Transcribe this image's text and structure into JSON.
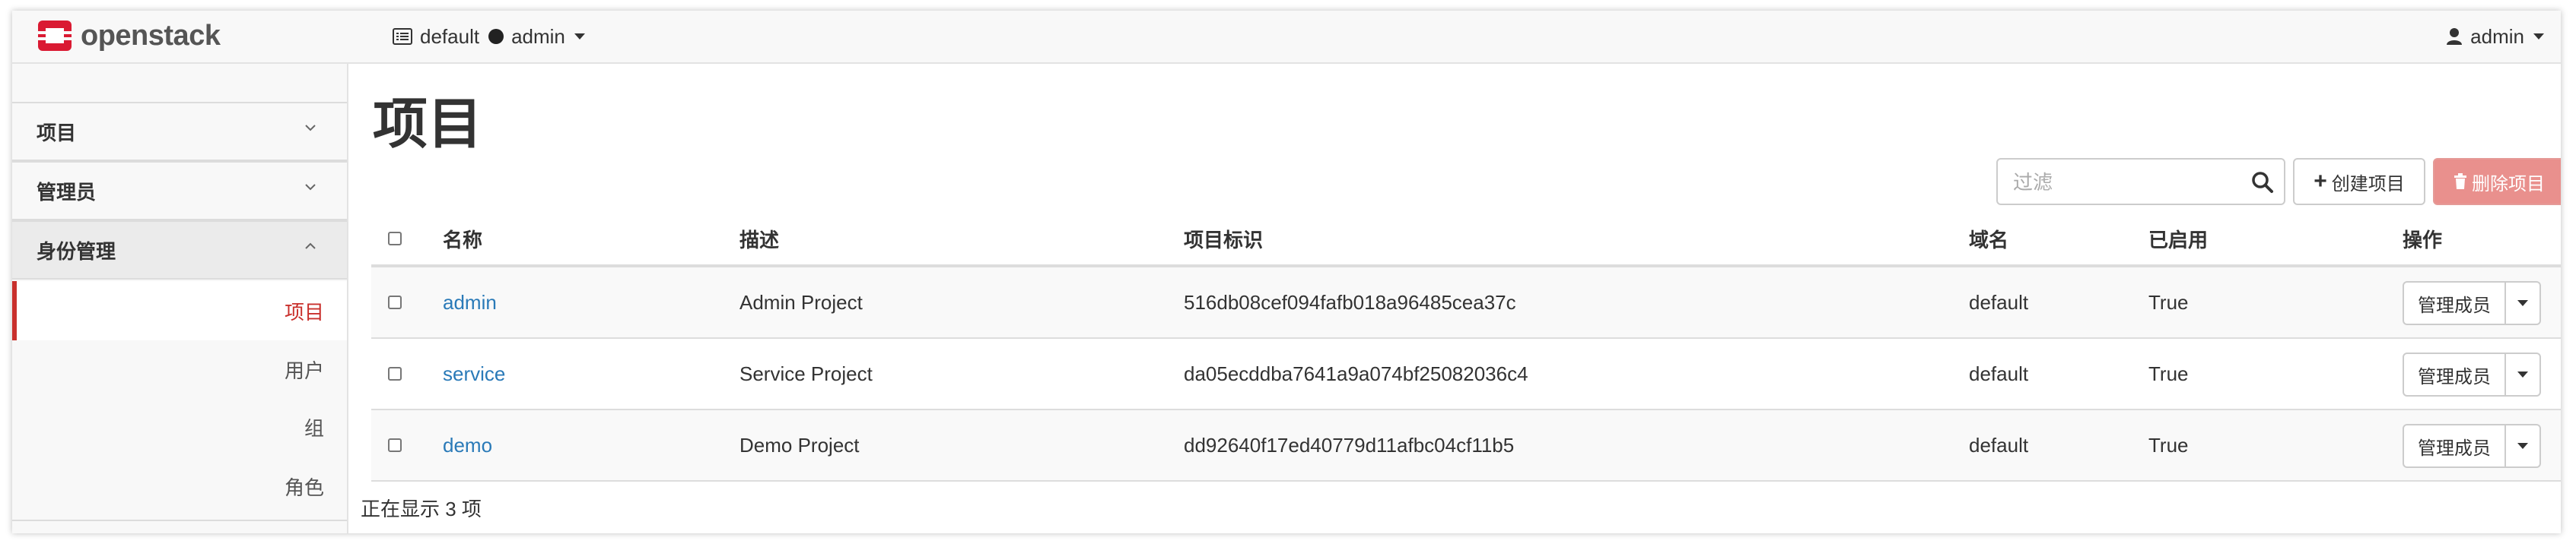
{
  "colors": {
    "accent_red": "#c9302c",
    "link_blue": "#2a7ab8",
    "logo_red": "#da1a32"
  },
  "navbar": {
    "brand": "openstack",
    "domain": "default",
    "project": "admin",
    "user": "admin"
  },
  "sidebar": {
    "sections": [
      {
        "label": "项目",
        "icon": "chevron-down-icon"
      },
      {
        "label": "管理员",
        "icon": "chevron-down-icon"
      },
      {
        "label": "身份管理",
        "icon": "chevron-up-icon"
      }
    ],
    "items": [
      {
        "label": "项目",
        "active": true
      },
      {
        "label": "用户"
      },
      {
        "label": "组"
      },
      {
        "label": "角色"
      }
    ]
  },
  "main": {
    "title": "项目",
    "filter_placeholder": "过滤",
    "create_label": "创建项目",
    "delete_label": "删除项目",
    "columns": [
      "名称",
      "描述",
      "项目标识",
      "域名",
      "已启用",
      "操作"
    ],
    "rows": [
      {
        "name": "admin",
        "description": "Admin Project",
        "id": "516db08cef094fafb018a96485cea37c",
        "domain": "default",
        "enabled": "True",
        "action": "管理成员"
      },
      {
        "name": "service",
        "description": "Service Project",
        "id": "da05ecddba7641a9a074bf25082036c4",
        "domain": "default",
        "enabled": "True",
        "action": "管理成员"
      },
      {
        "name": "demo",
        "description": "Demo Project",
        "id": "dd92640f17ed40779d11afbc04cf11b5",
        "domain": "default",
        "enabled": "True",
        "action": "管理成员"
      }
    ],
    "footer": "正在显示 3 项"
  }
}
